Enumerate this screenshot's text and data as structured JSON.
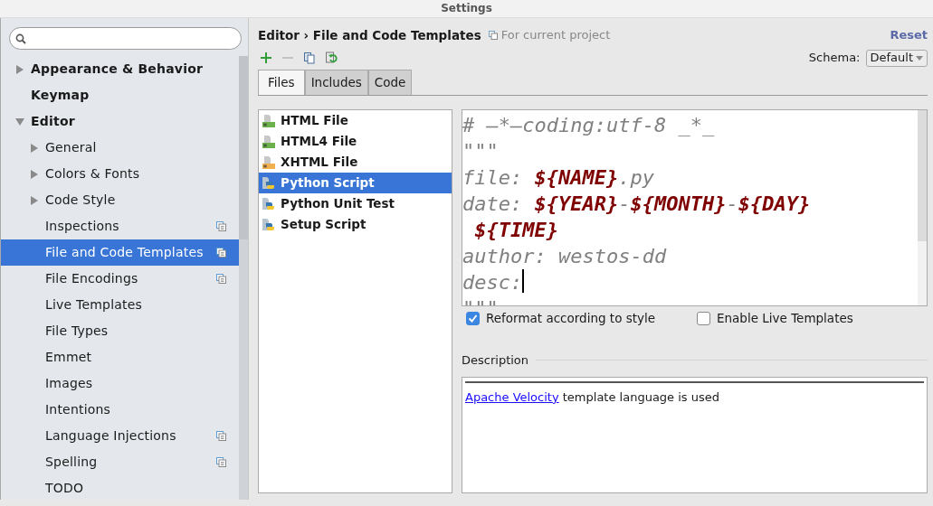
{
  "window": {
    "title": "Settings"
  },
  "sidebar": {
    "items": [
      {
        "label": "Appearance & Behavior",
        "expanded": false,
        "selected": false
      },
      {
        "label": "Keymap",
        "selected": false
      },
      {
        "label": "Editor",
        "expanded": true,
        "selected": false,
        "children": [
          {
            "label": "General",
            "expanded": false,
            "selected": false
          },
          {
            "label": "Colors & Fonts",
            "expanded": false,
            "selected": false
          },
          {
            "label": "Code Style",
            "expanded": false,
            "selected": false
          },
          {
            "label": "Inspections",
            "selected": false,
            "project_scoped": true
          },
          {
            "label": "File and Code Templates",
            "selected": true,
            "project_scoped": true
          },
          {
            "label": "File Encodings",
            "selected": false,
            "project_scoped": true
          },
          {
            "label": "Live Templates",
            "selected": false
          },
          {
            "label": "File Types",
            "selected": false
          },
          {
            "label": "Emmet",
            "selected": false
          },
          {
            "label": "Images",
            "selected": false
          },
          {
            "label": "Intentions",
            "selected": false
          },
          {
            "label": "Language Injections",
            "selected": false,
            "project_scoped": true
          },
          {
            "label": "Spelling",
            "selected": false,
            "project_scoped": true
          },
          {
            "label": "TODO",
            "selected": false
          }
        ]
      }
    ]
  },
  "header": {
    "breadcrumb": "Editor › File and Code Templates",
    "scope": "For current project",
    "reset": "Reset"
  },
  "toolbar": [
    {
      "kind": "add",
      "disabled": false
    },
    {
      "kind": "remove",
      "disabled": true
    },
    {
      "kind": "copy",
      "disabled": false
    },
    {
      "kind": "reset",
      "disabled": false
    }
  ],
  "schema": {
    "label": "Schema:",
    "value": "Default"
  },
  "tabs": [
    {
      "label": "Files",
      "selected": true
    },
    {
      "label": "Includes",
      "selected": false
    },
    {
      "label": "Code",
      "selected": false
    }
  ],
  "templates": [
    {
      "label": "HTML File",
      "kind": "html",
      "selected": false
    },
    {
      "label": "HTML4 File",
      "kind": "html",
      "selected": false
    },
    {
      "label": "XHTML File",
      "kind": "xhtml",
      "selected": false
    },
    {
      "label": "Python Script",
      "kind": "python",
      "selected": true
    },
    {
      "label": "Python Unit Test",
      "kind": "python",
      "selected": false
    },
    {
      "label": "Setup Script",
      "kind": "python",
      "selected": false
    }
  ],
  "code_lines": [
    [
      {
        "kind": "text",
        "text": "# —*—coding:utf-8 _*_"
      }
    ],
    [
      {
        "kind": "text",
        "text": "\"\"\""
      }
    ],
    [
      {
        "kind": "text",
        "text": "file: "
      },
      {
        "kind": "var",
        "text": "${NAME}"
      },
      {
        "kind": "text",
        "text": ".py"
      }
    ],
    [
      {
        "kind": "text",
        "text": "date: "
      },
      {
        "kind": "var",
        "text": "${YEAR}"
      },
      {
        "kind": "text",
        "text": "-"
      },
      {
        "kind": "var",
        "text": "${MONTH}"
      },
      {
        "kind": "text",
        "text": "-"
      },
      {
        "kind": "var",
        "text": "${DAY}"
      }
    ],
    [
      {
        "kind": "indent"
      },
      {
        "kind": "var",
        "text": "${TIME}"
      }
    ],
    [
      {
        "kind": "text",
        "text": "author: westos-dd"
      }
    ],
    [
      {
        "kind": "text",
        "text": "desc:"
      },
      {
        "kind": "caret"
      }
    ],
    [
      {
        "kind": "text",
        "text": "\"\"\""
      }
    ]
  ],
  "options": [
    {
      "label": "Reformat according to style",
      "checked": true
    },
    {
      "label": "Enable Live Templates",
      "checked": false
    }
  ],
  "description": {
    "title": "Description",
    "link": "Apache Velocity",
    "text": " template language is used"
  }
}
